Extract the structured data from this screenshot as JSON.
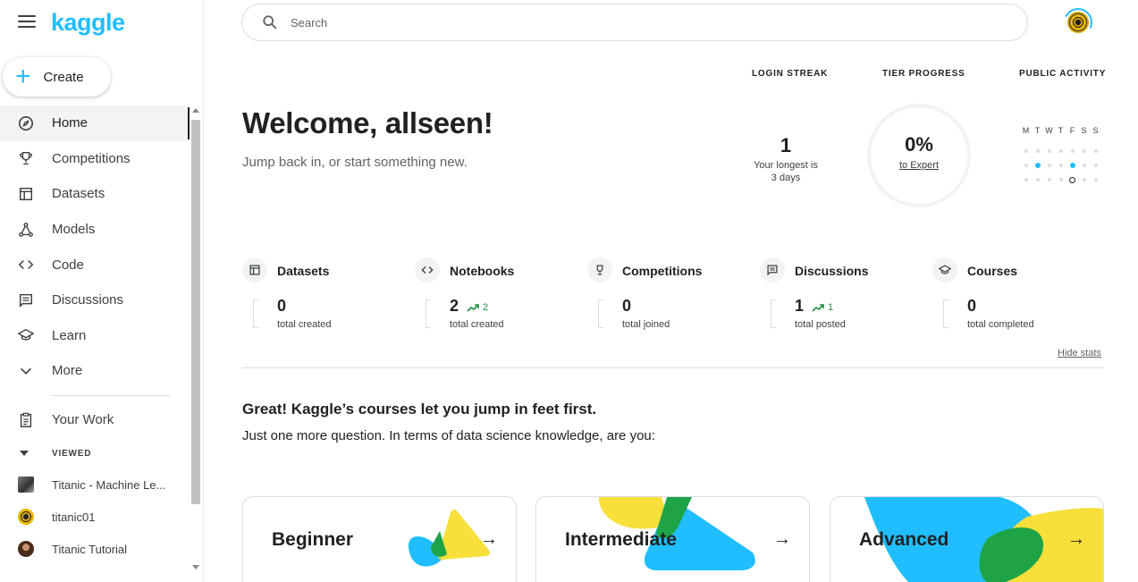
{
  "app": {
    "logo": "kaggle",
    "brand_color": "#20beff"
  },
  "sidebar": {
    "create_label": "Create",
    "items": [
      {
        "label": "Home",
        "icon": "compass-icon",
        "active": true
      },
      {
        "label": "Competitions",
        "icon": "trophy-icon"
      },
      {
        "label": "Datasets",
        "icon": "table-icon"
      },
      {
        "label": "Models",
        "icon": "models-icon"
      },
      {
        "label": "Code",
        "icon": "code-icon"
      },
      {
        "label": "Discussions",
        "icon": "comments-icon"
      },
      {
        "label": "Learn",
        "icon": "school-icon"
      },
      {
        "label": "More",
        "icon": "chevron-down-icon"
      }
    ],
    "your_work": "Your Work",
    "viewed_header": "VIEWED",
    "viewed": [
      {
        "label": "Titanic - Machine Le...",
        "icon": "titanic-thumbnail"
      },
      {
        "label": "titanic01",
        "icon": "coin-avatar"
      },
      {
        "label": "Titanic Tutorial",
        "icon": "user-avatar"
      }
    ]
  },
  "header": {
    "search_placeholder": "Search"
  },
  "main": {
    "welcome": "Welcome, allseen!",
    "subtitle": "Jump back in, or start something new.",
    "login_streak": {
      "header": "LOGIN STREAK",
      "value": "1",
      "sub_line1": "Your longest is",
      "sub_line2": "3 days"
    },
    "tier_progress": {
      "header": "TIER PROGRESS",
      "value": "0%",
      "link": "to Expert",
      "progress": 0
    },
    "public_activity": {
      "header": "PUBLIC ACTIVITY",
      "days": [
        "M",
        "T",
        "W",
        "T",
        "F",
        "S",
        "S"
      ],
      "grid": [
        [
          0,
          0,
          0,
          0,
          0,
          0,
          0
        ],
        [
          0,
          1,
          0,
          0,
          1,
          0,
          0
        ],
        [
          0,
          0,
          0,
          0,
          2,
          0,
          0
        ]
      ]
    },
    "stats": [
      {
        "name": "Datasets",
        "icon": "table-icon",
        "value": "0",
        "trend": "",
        "sub": "total created"
      },
      {
        "name": "Notebooks",
        "icon": "code-icon",
        "value": "2",
        "trend": "2",
        "sub": "total created"
      },
      {
        "name": "Competitions",
        "icon": "trophy-icon",
        "value": "0",
        "trend": "",
        "sub": "total joined"
      },
      {
        "name": "Discussions",
        "icon": "comments-icon",
        "value": "1",
        "trend": "1",
        "sub": "total posted"
      },
      {
        "name": "Courses",
        "icon": "school-icon",
        "value": "0",
        "trend": "",
        "sub": "total completed"
      }
    ],
    "hide_stats": "Hide stats",
    "great": "Great! Kaggle’s courses let you jump in feet first.",
    "question": "Just one more question. In terms of data science knowledge, are you:",
    "levels": [
      {
        "label": "Beginner",
        "arrow": "→"
      },
      {
        "label": "Intermediate",
        "arrow": "→"
      },
      {
        "label": "Advanced",
        "arrow": "→"
      }
    ],
    "colors": {
      "blue": "#20beff",
      "yellow": "#f8df3a",
      "green": "#1ea446",
      "trend_green": "#1e8e3e"
    }
  }
}
